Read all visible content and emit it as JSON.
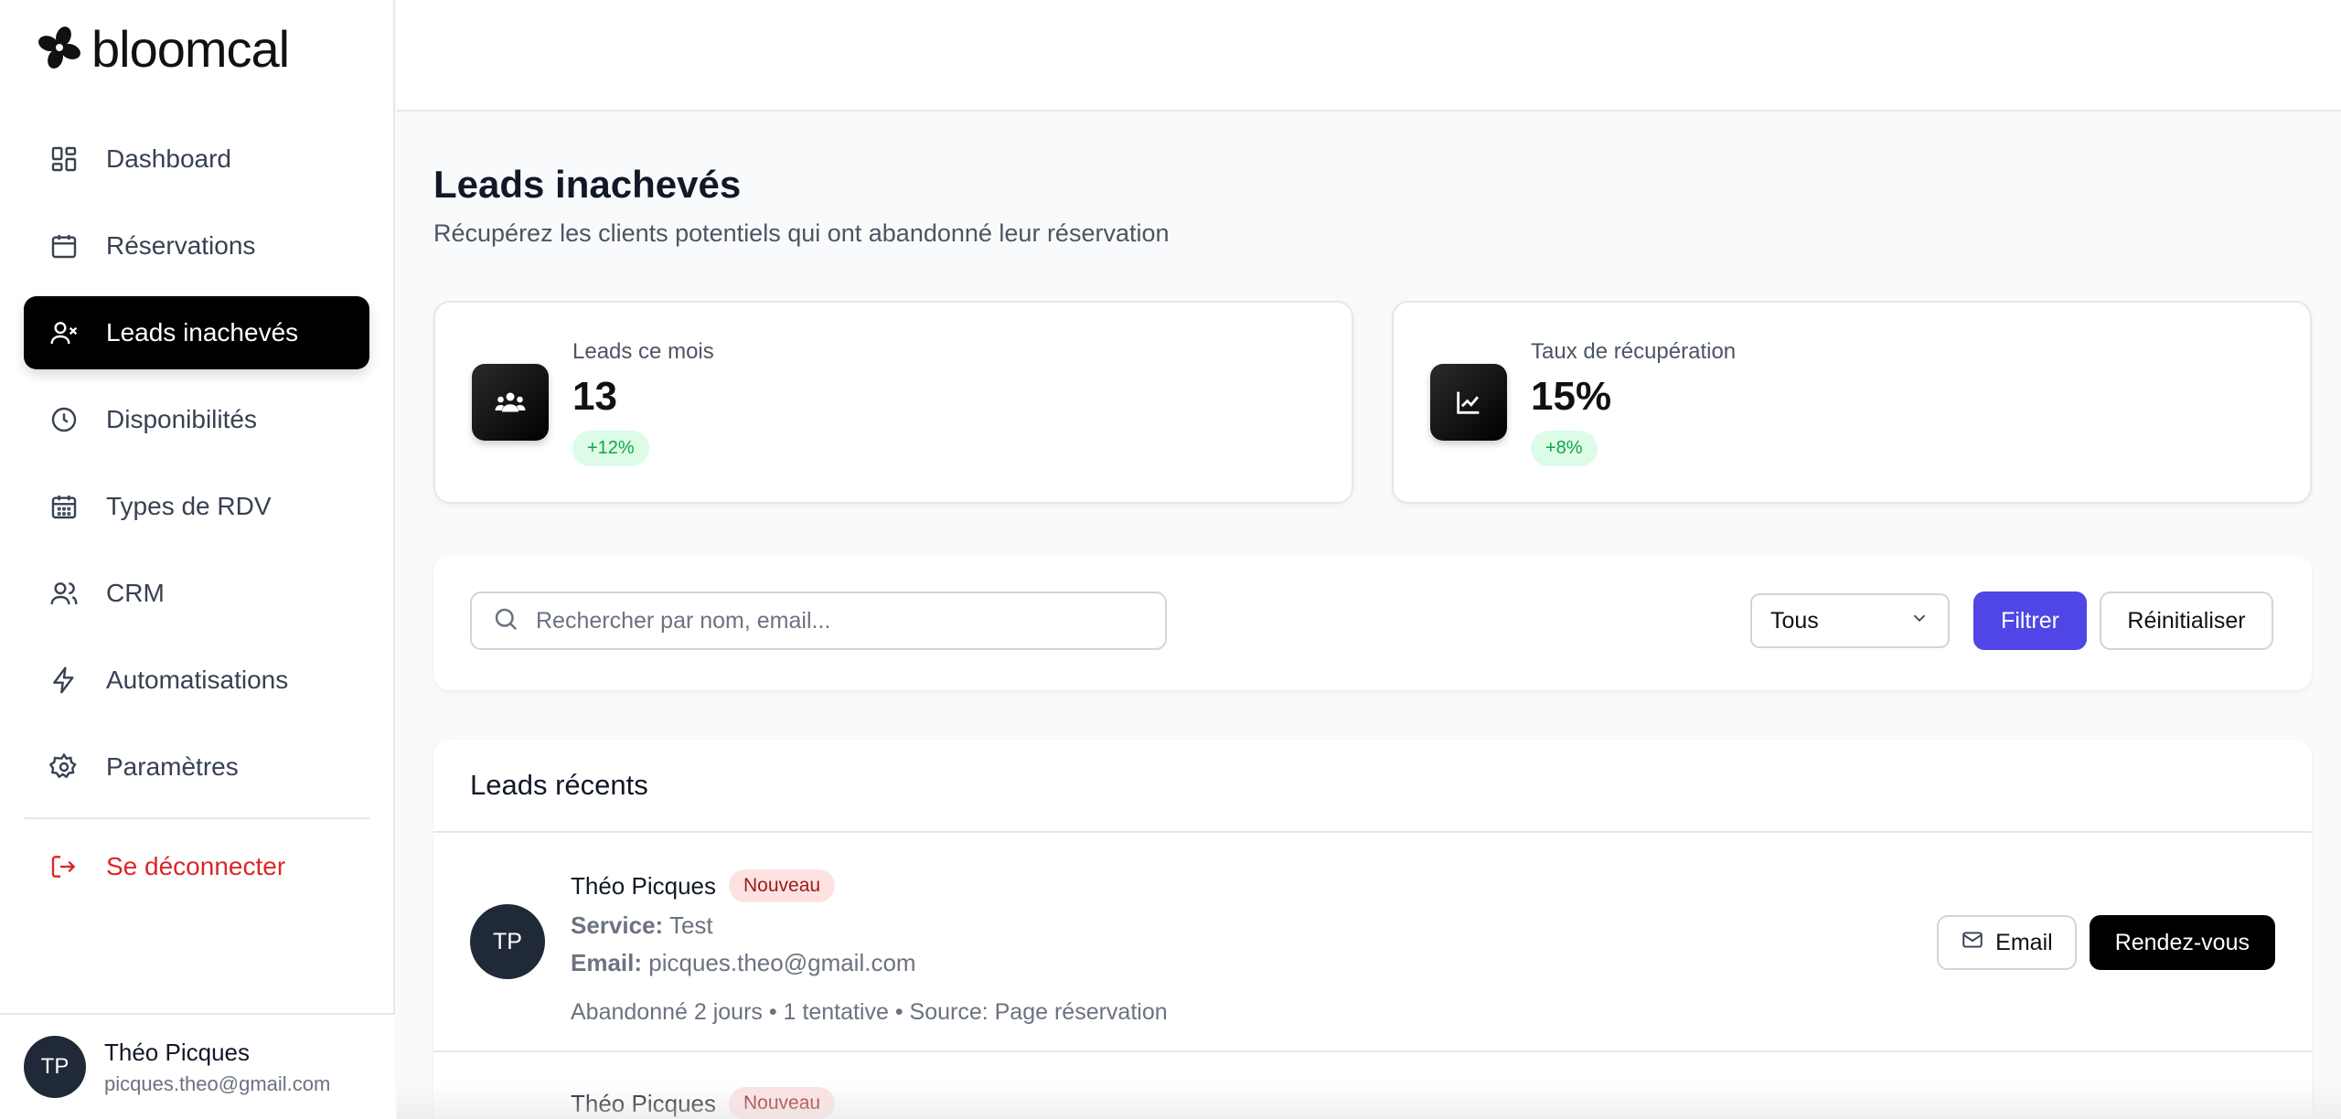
{
  "app": {
    "brand": "bloomcal"
  },
  "sidebar": {
    "items": [
      {
        "label": "Dashboard",
        "icon": "dashboard-icon",
        "active": false
      },
      {
        "label": "Réservations",
        "icon": "calendar-icon",
        "active": false
      },
      {
        "label": "Leads inachevés",
        "icon": "user-x-icon",
        "active": true
      },
      {
        "label": "Disponibilités",
        "icon": "clock-icon",
        "active": false
      },
      {
        "label": "Types de RDV",
        "icon": "calendar-grid-icon",
        "active": false
      },
      {
        "label": "CRM",
        "icon": "users-icon",
        "active": false
      },
      {
        "label": "Automatisations",
        "icon": "bolt-icon",
        "active": false
      },
      {
        "label": "Paramètres",
        "icon": "gear-icon",
        "active": false
      }
    ],
    "logout_label": "Se déconnecter",
    "user": {
      "initials": "TP",
      "name": "Théo Picques",
      "email": "picques.theo@gmail.com"
    }
  },
  "page": {
    "title": "Leads inachevés",
    "subtitle": "Récupérez les clients potentiels qui ont abandonné leur réservation"
  },
  "stats": [
    {
      "label": "Leads ce mois",
      "value": "13",
      "badge": "+12%",
      "icon": "group-icon"
    },
    {
      "label": "Taux de récupération",
      "value": "15%",
      "badge": "+8%",
      "icon": "trend-chart-icon"
    }
  ],
  "filters": {
    "search_placeholder": "Rechercher par nom, email...",
    "select_value": "Tous",
    "filter_label": "Filtrer",
    "reset_label": "Réinitialiser"
  },
  "leads": {
    "heading": "Leads récents",
    "rows": [
      {
        "initials": "TP",
        "name": "Théo Picques",
        "badge": "Nouveau",
        "service_label": "Service:",
        "service": "Test",
        "email_label": "Email:",
        "email": "picques.theo@gmail.com",
        "meta": "Abandonné 2 jours • 1 tentative • Source: Page réservation",
        "email_button": "Email",
        "rdv_button": "Rendez-vous"
      },
      {
        "name": "Théo Picques",
        "badge": "Nouveau"
      }
    ]
  },
  "colors": {
    "accent": "#4f46e5",
    "danger": "#dc2626",
    "success": "#16a34a"
  }
}
